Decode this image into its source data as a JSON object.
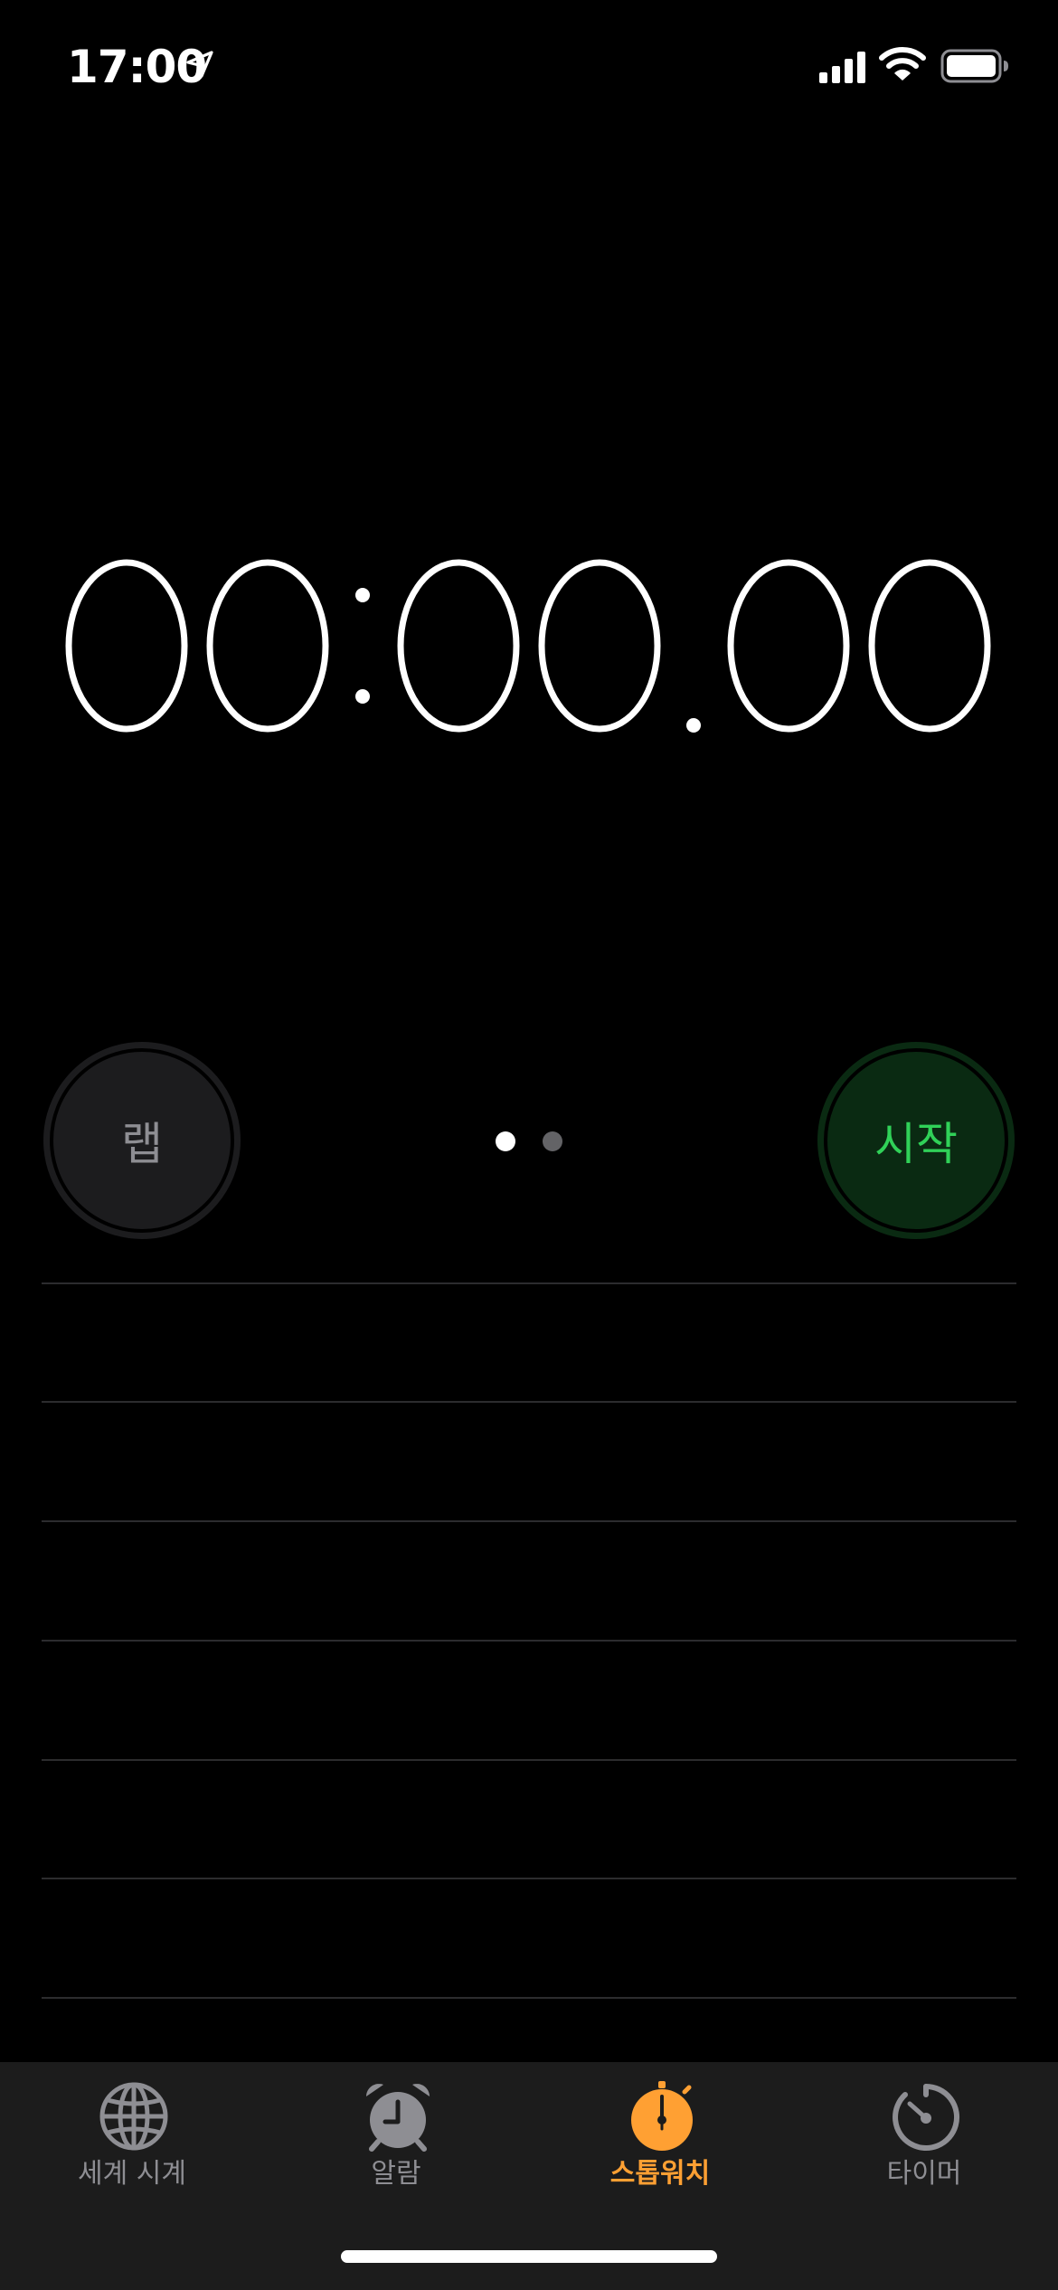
{
  "status_bar": {
    "time": "17:00",
    "icons": [
      "location-arrow-icon",
      "cellular-signal-icon",
      "wifi-icon",
      "battery-icon"
    ]
  },
  "stopwatch": {
    "display": "00:00.00",
    "digits": [
      "0",
      "0",
      "0",
      "0",
      "0",
      "0"
    ],
    "separators": [
      ":",
      "."
    ]
  },
  "controls": {
    "lap_label": "랩",
    "start_label": "시작",
    "page_count": 2,
    "current_page": 1
  },
  "lap_list": {
    "rows": []
  },
  "tab_bar": {
    "tabs": [
      {
        "label": "세계 시계",
        "icon": "globe-icon",
        "active": false
      },
      {
        "label": "알람",
        "icon": "alarm-clock-icon",
        "active": false
      },
      {
        "label": "스톱워치",
        "icon": "stopwatch-icon",
        "active": true
      },
      {
        "label": "타이머",
        "icon": "timer-icon",
        "active": false
      }
    ]
  },
  "colors": {
    "background": "#000000",
    "accent": "#ffa033",
    "start_green": "#30d158",
    "lap_gray": "#8e8e93",
    "separator": "#2c2c2e",
    "tab_bar_bg": "#1c1c1c"
  }
}
